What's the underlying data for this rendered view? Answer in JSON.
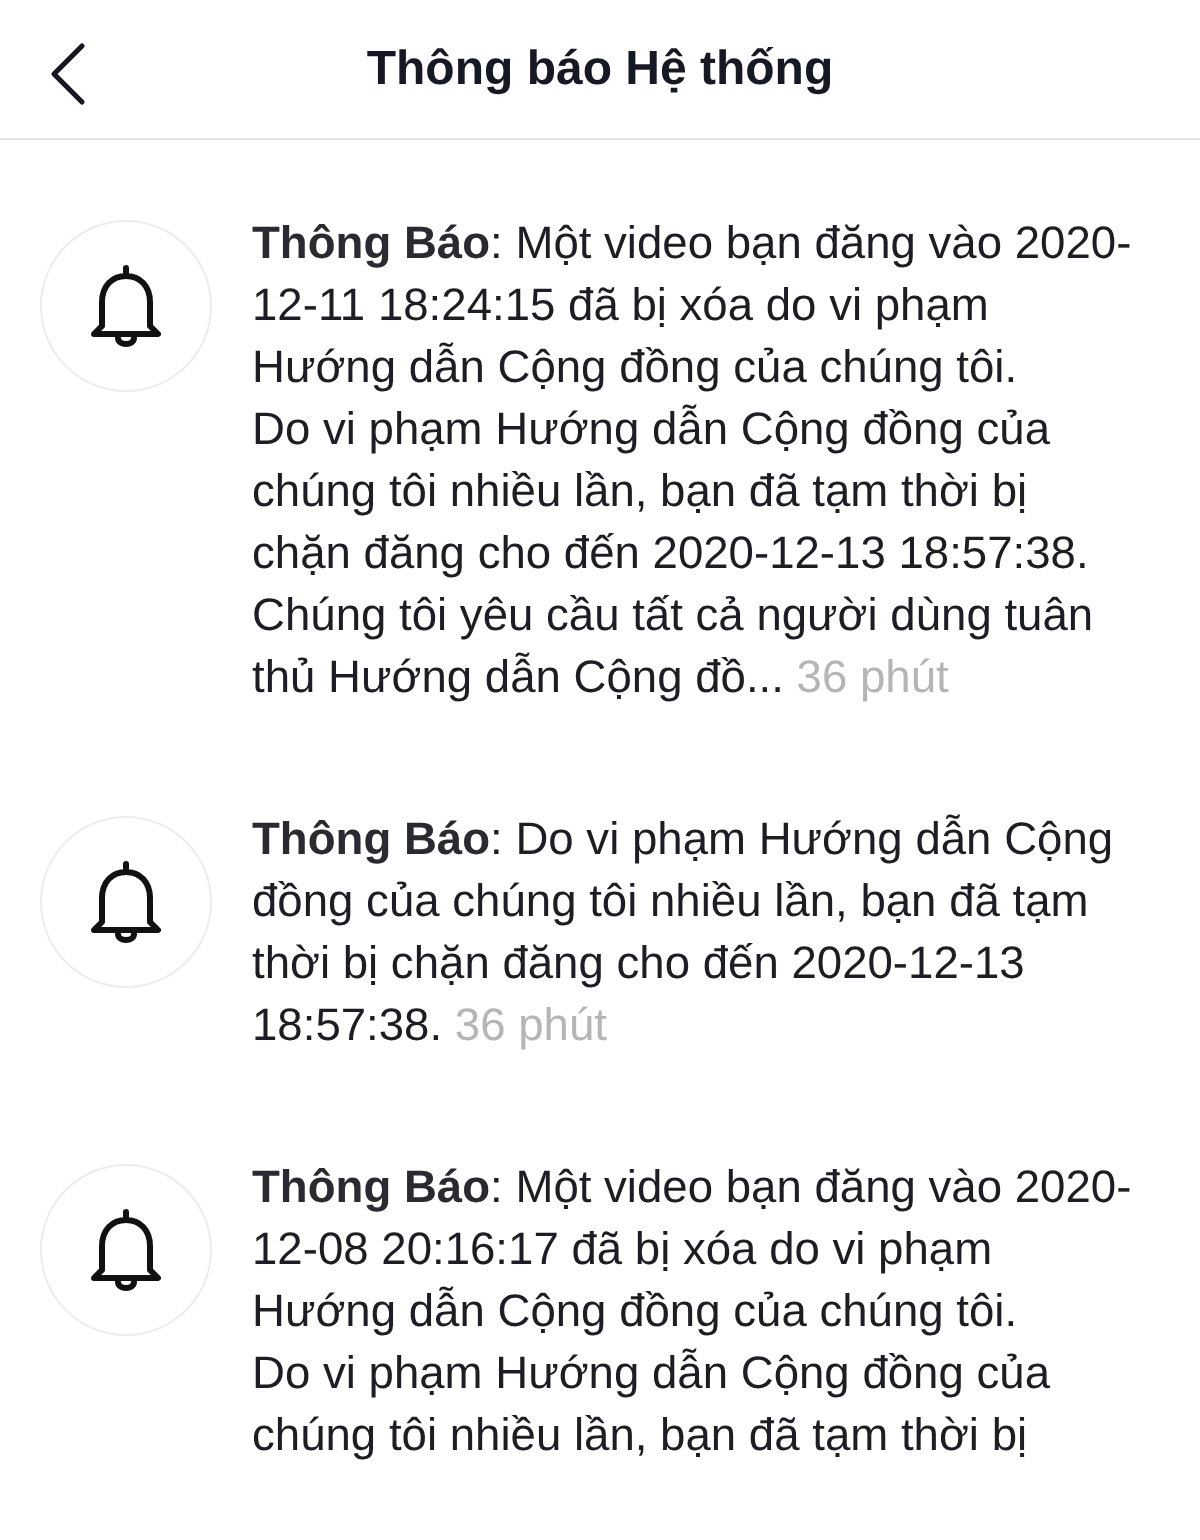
{
  "header": {
    "title": "Thông báo Hệ thống"
  },
  "notifications": [
    {
      "text": "**Thông Báo**: Một video bạn đăng vào 2020-12-11 18:24:15 đã bị xóa do vi phạm Hướng dẫn Cộng đồng của chúng tôi.\nDo vi phạm Hướng dẫn Cộng đồng của chúng tôi nhiều lần, bạn đã tạm thời bị chặn đăng cho đến 2020-12-13 18:57:38.\nChúng tôi yêu cầu tất cả người dùng tuân thủ Hướng dẫn Cộng đồ...",
      "time": "36 phút"
    },
    {
      "text": "**Thông Báo**: Do vi phạm Hướng dẫn Cộng đồng của chúng tôi nhiều lần, bạn đã tạm thời bị chặn đăng cho đến 2020-12-13 18:57:38.",
      "time": "36 phút"
    },
    {
      "text": "**Thông Báo**: Một video bạn đăng vào 2020-12-08 20:16:17 đã bị xóa do vi phạm Hướng dẫn Cộng đồng của chúng tôi.\nDo vi phạm Hướng dẫn Cộng đồng của chúng tôi nhiều lần, bạn đã tạm thời bị"
    }
  ]
}
